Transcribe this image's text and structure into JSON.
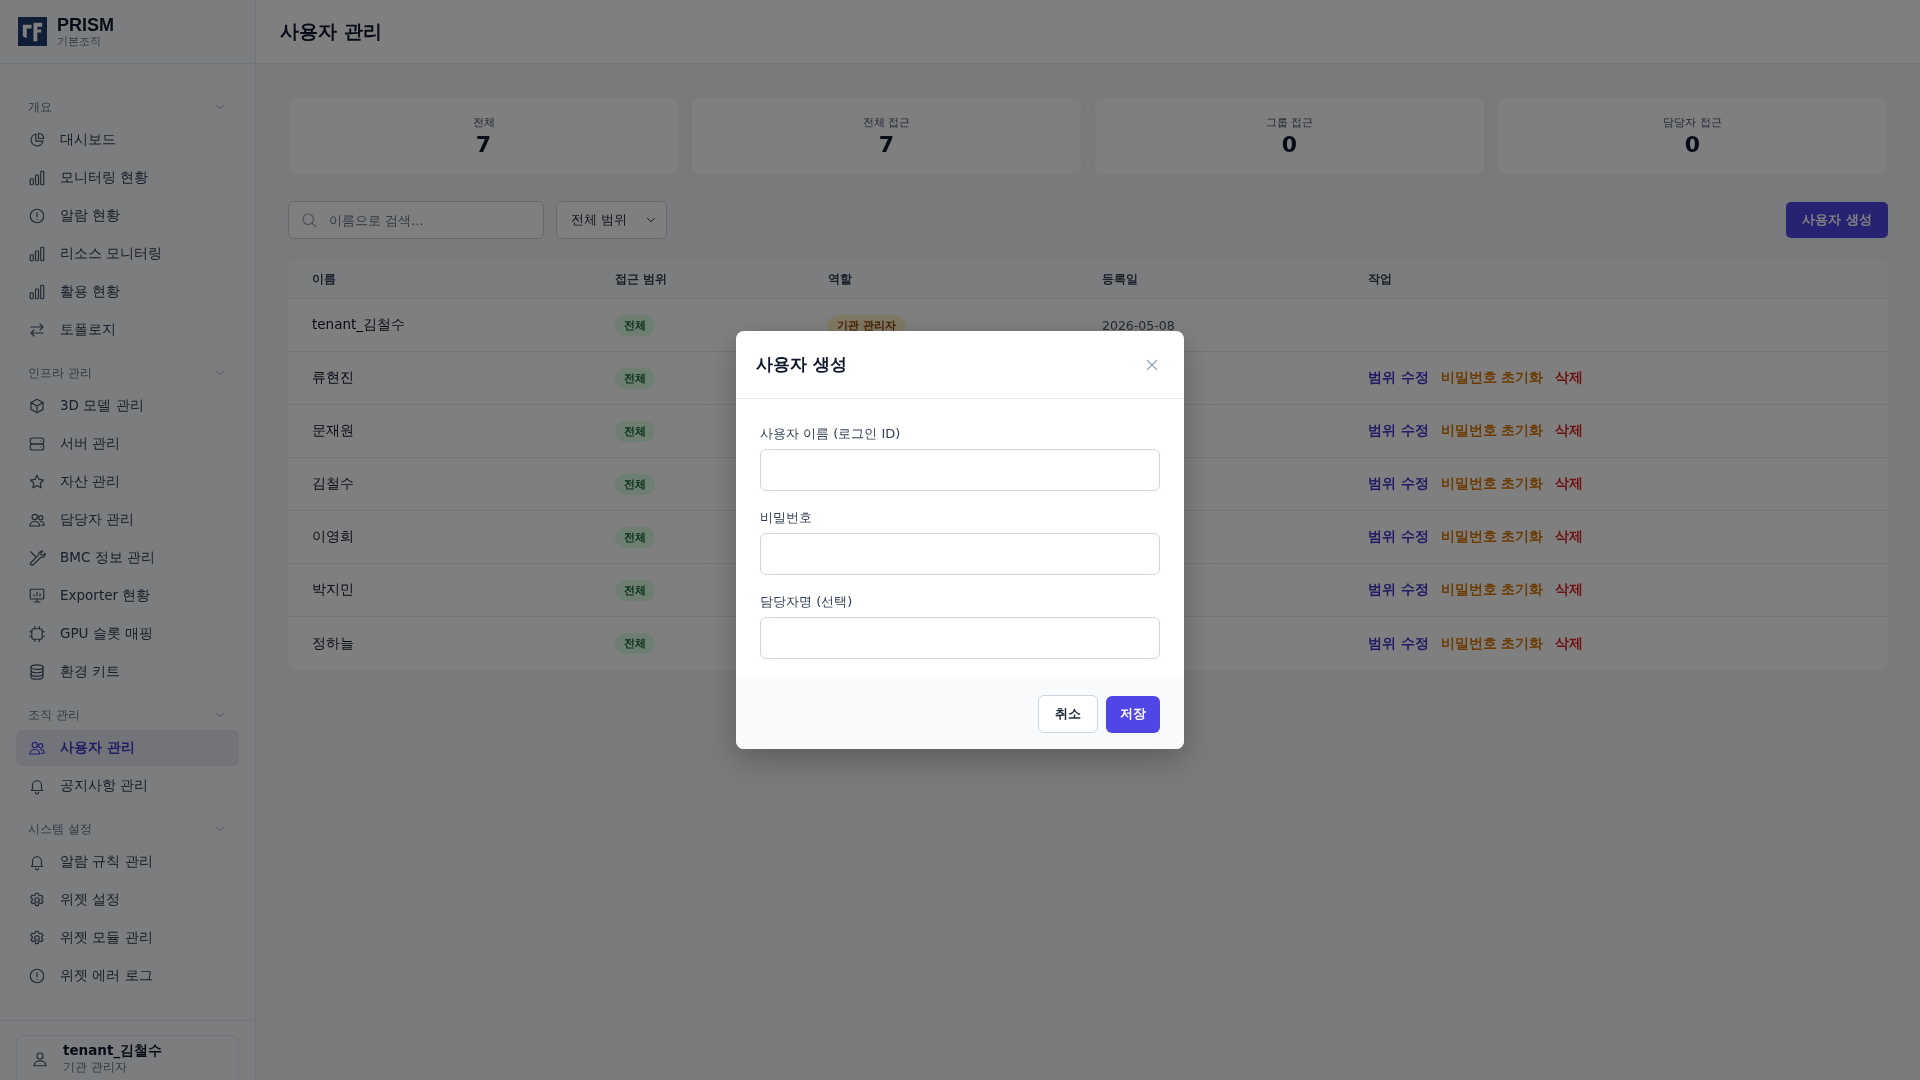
{
  "sidebar": {
    "logo": {
      "title": "PRISM",
      "subtitle": "기본조직"
    },
    "groups": [
      {
        "label": "개요",
        "expanded": true,
        "items": [
          {
            "label": "대시보드",
            "selected": false
          },
          {
            "label": "모니터링 현황",
            "selected": false
          },
          {
            "label": "알람 현황",
            "selected": false
          },
          {
            "label": "리소스 모니터링",
            "selected": false
          },
          {
            "label": "활용 현황",
            "selected": false
          },
          {
            "label": "토폴로지",
            "selected": false
          }
        ]
      },
      {
        "label": "인프라 관리",
        "expanded": true,
        "items": [
          {
            "label": "3D 모델 관리",
            "selected": false
          },
          {
            "label": "서버 관리",
            "selected": false
          },
          {
            "label": "자산 관리",
            "selected": false
          },
          {
            "label": "담당자 관리",
            "selected": false
          },
          {
            "label": "BMC 정보 관리",
            "selected": false
          },
          {
            "label": "Exporter 현황",
            "selected": false
          },
          {
            "label": "GPU 슬롯 매핑",
            "selected": false
          },
          {
            "label": "환경 키트",
            "selected": false
          }
        ]
      },
      {
        "label": "조직 관리",
        "expanded": true,
        "items": [
          {
            "label": "사용자 관리",
            "selected": true
          },
          {
            "label": "공지사항 관리",
            "selected": false
          }
        ]
      },
      {
        "label": "시스템 설정",
        "expanded": true,
        "items": [
          {
            "label": "알람 규칙 관리",
            "selected": false
          },
          {
            "label": "위젯 설정",
            "selected": false
          },
          {
            "label": "위젯 모듈 관리",
            "selected": false
          },
          {
            "label": "위젯 에러 로그",
            "selected": false
          }
        ]
      }
    ],
    "user": {
      "name": "tenant_김철수",
      "role": "기관 관리자"
    }
  },
  "page": {
    "title": "사용자 관리"
  },
  "stats": [
    {
      "label": "전체",
      "value": "7"
    },
    {
      "label": "전체 접근",
      "value": "7"
    },
    {
      "label": "그룹 접근",
      "value": "0"
    },
    {
      "label": "담당자 접근",
      "value": "0"
    }
  ],
  "toolbar": {
    "search": {
      "placeholder": "이름으로 검색..."
    },
    "filter": {
      "value": "전체 범위"
    },
    "create_button": "사용자 생성"
  },
  "table": {
    "columns": [
      "이름",
      "접근 범위",
      "역할",
      "등록일",
      "작업"
    ],
    "rows": [
      {
        "name": "tenant_김철수",
        "scope": "전체",
        "role": "기관 관리자",
        "date": "2026-05-08",
        "actions": []
      },
      {
        "name": "류현진",
        "scope": "전체",
        "actions": [
          {
            "label": "범위 수정",
            "kind": "edit"
          },
          {
            "label": "비밀번호 초기화",
            "kind": "reset"
          },
          {
            "label": "삭제",
            "kind": "delete"
          }
        ]
      },
      {
        "name": "문재원",
        "scope": "전체",
        "actions": [
          {
            "label": "범위 수정",
            "kind": "edit"
          },
          {
            "label": "비밀번호 초기화",
            "kind": "reset"
          },
          {
            "label": "삭제",
            "kind": "delete"
          }
        ]
      },
      {
        "name": "김철수",
        "scope": "전체",
        "actions": [
          {
            "label": "범위 수정",
            "kind": "edit"
          },
          {
            "label": "비밀번호 초기화",
            "kind": "reset"
          },
          {
            "label": "삭제",
            "kind": "delete"
          }
        ]
      },
      {
        "name": "이영희",
        "scope": "전체",
        "actions": [
          {
            "label": "범위 수정",
            "kind": "edit"
          },
          {
            "label": "비밀번호 초기화",
            "kind": "reset"
          },
          {
            "label": "삭제",
            "kind": "delete"
          }
        ]
      },
      {
        "name": "박지민",
        "scope": "전체",
        "actions": [
          {
            "label": "범위 수정",
            "kind": "edit"
          },
          {
            "label": "비밀번호 초기화",
            "kind": "reset"
          },
          {
            "label": "삭제",
            "kind": "delete"
          }
        ]
      },
      {
        "name": "정하늘",
        "scope": "전체",
        "actions": [
          {
            "label": "범위 수정",
            "kind": "edit"
          },
          {
            "label": "비밀번호 초기화",
            "kind": "reset"
          },
          {
            "label": "삭제",
            "kind": "delete"
          }
        ]
      }
    ]
  },
  "modal": {
    "title": "사용자 생성",
    "fields": [
      {
        "label": "사용자 이름 (로그인 ID)"
      },
      {
        "label": "비밀번호"
      },
      {
        "label": "담당자명 (선택)"
      }
    ],
    "buttons": [
      {
        "label": "취소",
        "kind": "secondary"
      },
      {
        "label": "저장",
        "kind": "primary"
      }
    ]
  }
}
